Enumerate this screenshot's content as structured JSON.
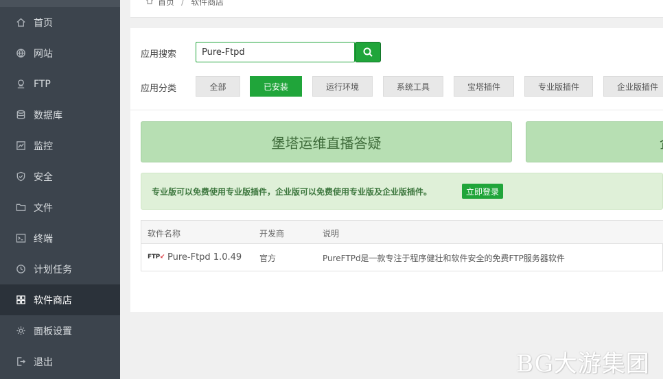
{
  "sidebar": {
    "items": [
      {
        "label": "首页",
        "icon": "home-icon"
      },
      {
        "label": "网站",
        "icon": "globe-icon"
      },
      {
        "label": "FTP",
        "icon": "ftp-icon"
      },
      {
        "label": "数据库",
        "icon": "database-icon"
      },
      {
        "label": "监控",
        "icon": "monitor-icon"
      },
      {
        "label": "安全",
        "icon": "shield-icon"
      },
      {
        "label": "文件",
        "icon": "folder-icon"
      },
      {
        "label": "终端",
        "icon": "terminal-icon"
      },
      {
        "label": "计划任务",
        "icon": "clock-icon"
      },
      {
        "label": "软件商店",
        "icon": "grid-icon",
        "active": true
      },
      {
        "label": "面板设置",
        "icon": "gear-icon"
      },
      {
        "label": "退出",
        "icon": "logout-icon"
      }
    ]
  },
  "breadcrumb": {
    "home": "首页",
    "separator": "/",
    "current": "软件商店"
  },
  "search": {
    "label": "应用搜索",
    "value": "Pure-Ftpd"
  },
  "category": {
    "label": "应用分类",
    "items": [
      "全部",
      "已安装",
      "运行环境",
      "系统工具",
      "宝塔插件",
      "专业版插件",
      "企业版插件"
    ],
    "active_index": 1
  },
  "banners": [
    "堡塔运维直播答疑",
    "企"
  ],
  "notice": {
    "text": "专业版可以免费使用专业版插件，企业版可以免费使用专业版及企业版插件。",
    "button": "立即登录"
  },
  "table": {
    "headers": [
      "软件名称",
      "开发商",
      "说明"
    ],
    "rows": [
      {
        "logo": "FTP",
        "name": "Pure-Ftpd 1.0.49",
        "vendor": "官方",
        "desc": "PureFTPd是一款专注于程序健壮和软件安全的免费FTP服务器软件"
      }
    ]
  },
  "watermark": "BG大游集团",
  "colors": {
    "accent": "#20a53a",
    "sidebar": "#3c444d",
    "sidebar_active": "#2b323a",
    "banner": "#b7dfb3",
    "notice": "#dff0d8"
  }
}
